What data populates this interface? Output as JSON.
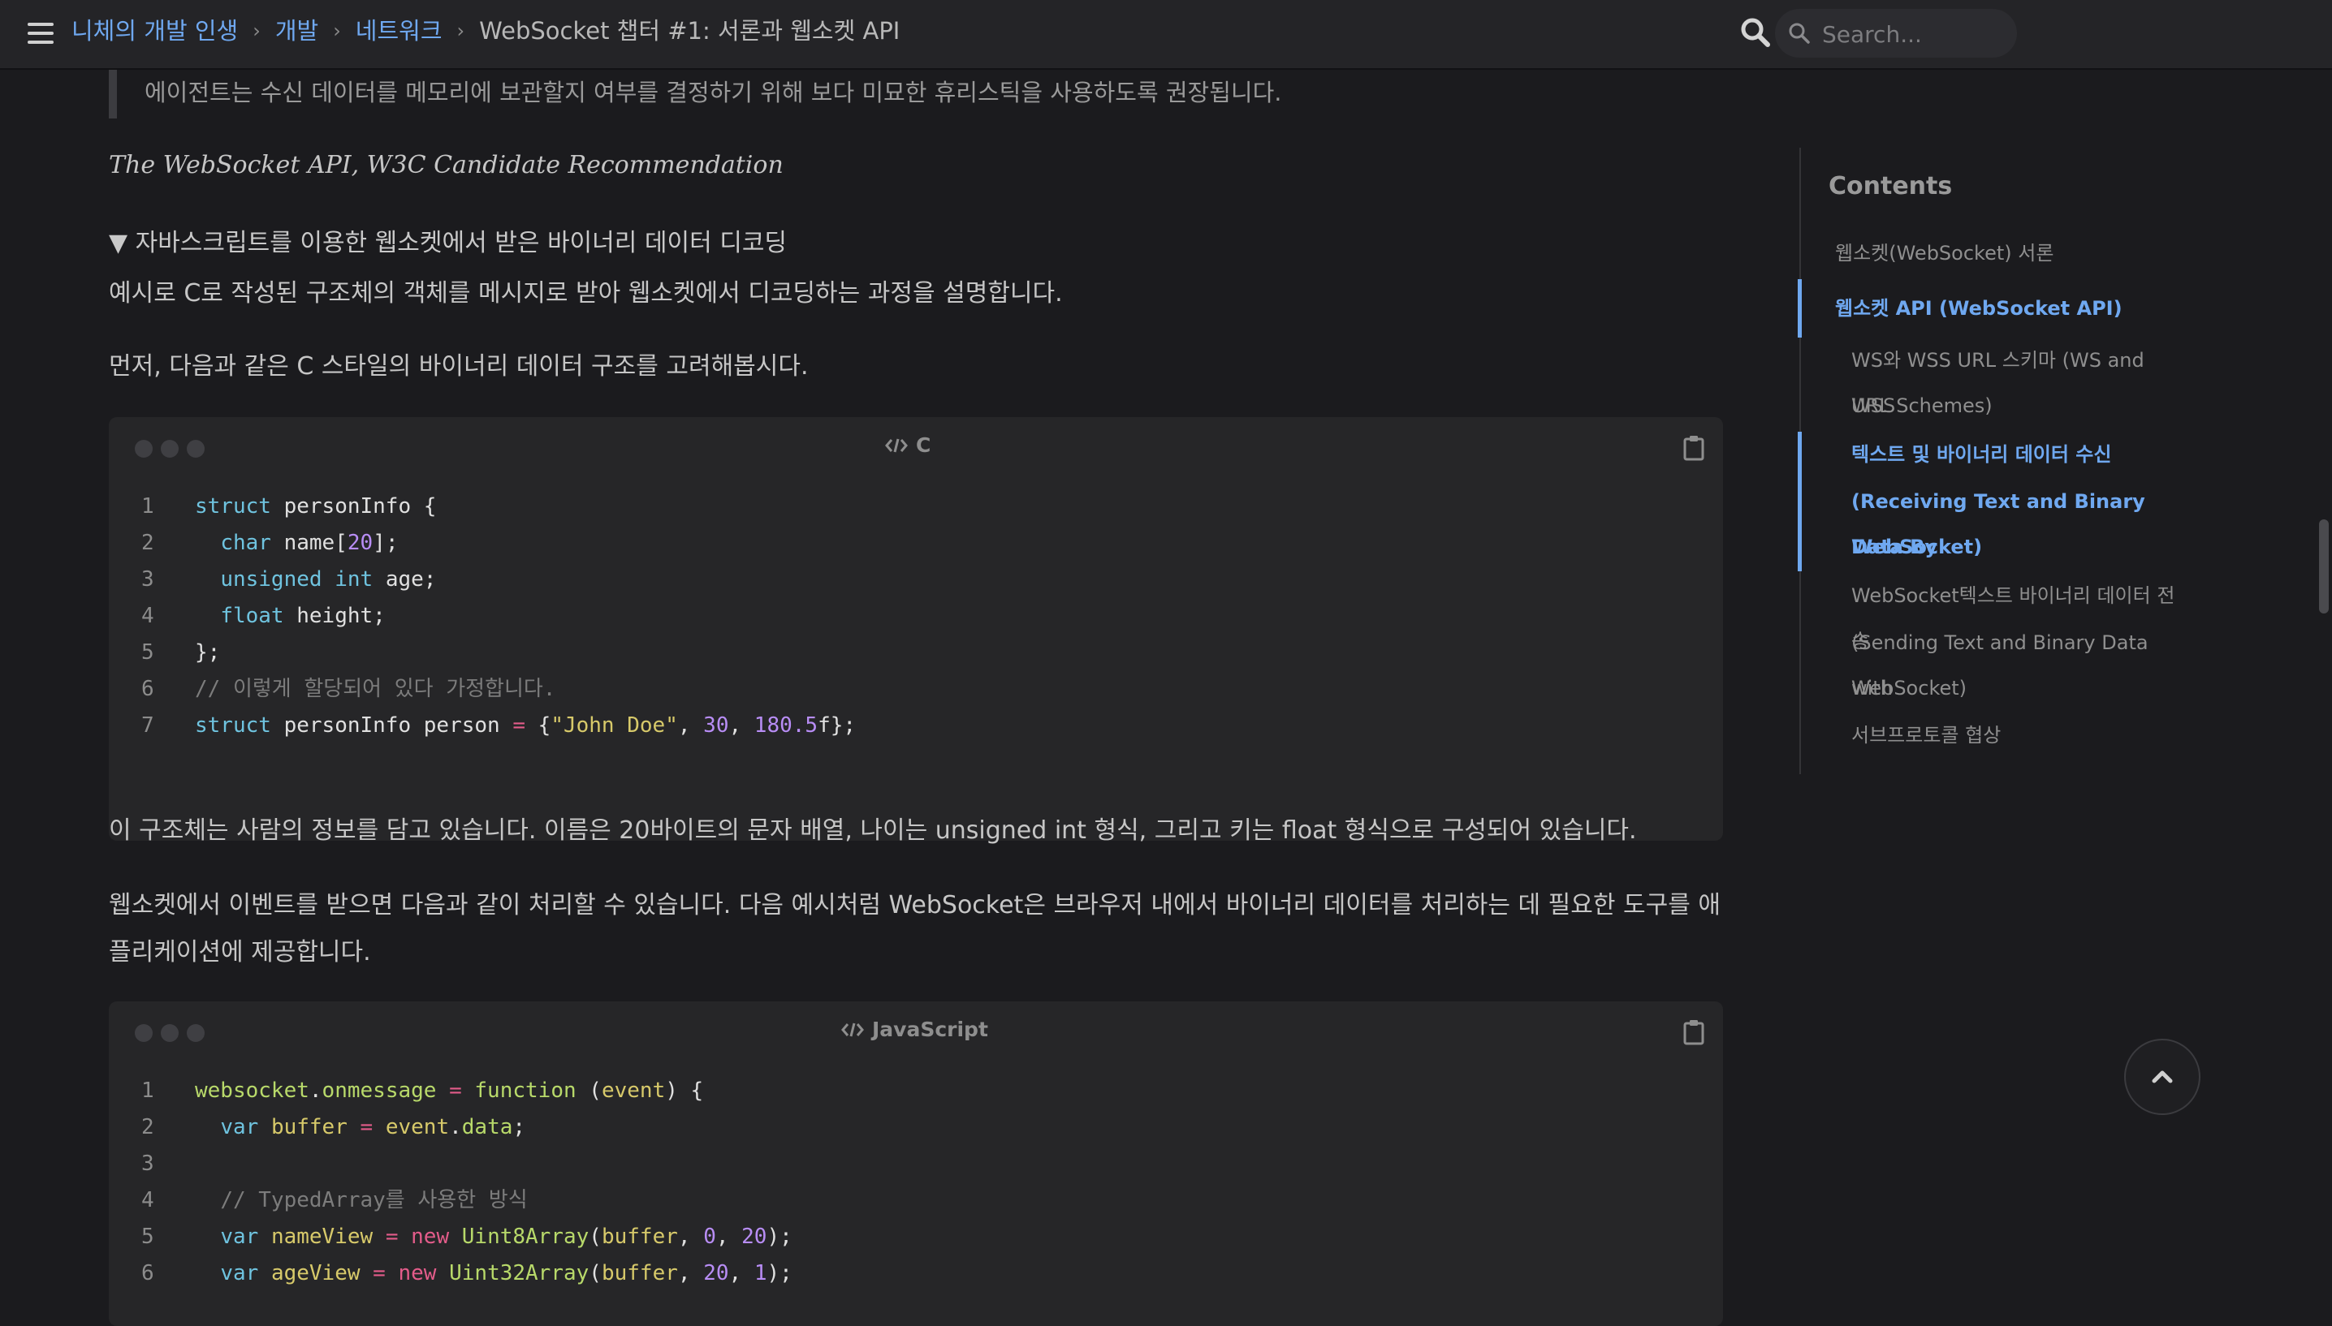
{
  "header": {
    "breadcrumb": {
      "blog": "니체의 개발 인생",
      "category": "개발",
      "subcategory": "네트워크",
      "current": "WebSocket 챕터 #1: 서론과 웹소켓 API"
    },
    "search_placeholder": "Search..."
  },
  "article": {
    "quote": "에이전트는 수신 데이터를 메모리에 보관할지 여부를 결정하기 위해 보다 미묘한 휴리스틱을 사용하도록 권장됩니다.",
    "citation": "The WebSocket API, W3C Candidate Recommendation",
    "details_summary": "▼ 자바스크립트를 이용한 웹소켓에서 받은 바이너리 데이터 디코딩",
    "para1": "예시로 C로 작성된 구조체의 객체를 메시지로 받아 웹소켓에서 디코딩하는 과정을 설명합니다.",
    "para2": "먼저, 다음과 같은 C 스타일의 바이너리 데이터 구조를 고려해봅시다.",
    "para3": "이 구조체는 사람의 정보를 담고 있습니다. 이름은 20바이트의 문자 배열, 나이는 unsigned int 형식, 그리고 키는 float 형식으로 구성되어 있습니다.",
    "para4_line1": "웹소켓에서 이벤트를 받으면 다음과 같이 처리할 수 있습니다. 다음 예시처럼 WebSocket은 브라우저 내에서 바이너리 데이터를 처리하는 데 필요한 도구를 애",
    "para4_line2": "플리케이션에 제공합니다."
  },
  "code_c": {
    "language": "C",
    "line_numbers": [
      "1",
      "2",
      "3",
      "4",
      "5",
      "6",
      "7"
    ],
    "l1": {
      "kw": "struct",
      "rest": " personInfo {"
    },
    "l2": {
      "kw": "char",
      "a": " name[",
      "num": "20",
      "b": "];"
    },
    "l3": {
      "kw1": "unsigned",
      "kw2": "int",
      "rest": " age;"
    },
    "l4": {
      "kw": "float",
      "rest": " height;"
    },
    "l5": "};",
    "l6": "// 이렇게 할당되어 있다 가정합니다.",
    "l7": {
      "kw": "struct",
      "a": " personInfo person ",
      "op": "=",
      "b": " {",
      "str": "\"John Doe\"",
      "c": ", ",
      "n1": "30",
      "d": ", ",
      "n2": "180.5",
      "e": "f};"
    }
  },
  "code_js": {
    "language": "JavaScript",
    "line_numbers": [
      "1",
      "2",
      "3",
      "4",
      "5",
      "6"
    ],
    "l1": {
      "obj": "websocket",
      "dot": ".",
      "prop": "onmessage",
      "op": " = ",
      "kw": "function",
      "rest": " (",
      "param": "event",
      "end": ") {"
    },
    "l2": {
      "kw": "var",
      "a": " ",
      "name": "buffer",
      "op": " = ",
      "obj": "event",
      "b": ".",
      "prop": "data",
      "end": ";"
    },
    "l4": "// TypedArray를 사용한 방식",
    "l5": {
      "kw": "var",
      "a": " ",
      "name": "nameView",
      "op": " = ",
      "new": "new",
      "cls": " Uint8Array",
      "b": "(",
      "arg": "buffer",
      "c": ", ",
      "n1": "0",
      "d": ", ",
      "n2": "20",
      "e": ");"
    },
    "l6": {
      "kw": "var",
      "a": " ",
      "name": "ageView",
      "op": " = ",
      "new": "new",
      "cls": " Uint32Array",
      "b": "(",
      "arg": "buffer",
      "c": ", ",
      "n1": "20",
      "d": ", ",
      "n2": "1",
      "e": ");"
    }
  },
  "toc": {
    "title": "Contents",
    "items": [
      "웹소켓(WebSocket) 서론",
      "웹소켓 API (WebSocket API)",
      "WS와 WSS URL 스키마 (WS and WSS",
      "URL Schemes)",
      "텍스트 및 바이너리 데이터 수신",
      "(Receiving Text and Binary Data By",
      "WebSocket)",
      "WebSocket텍스트 바이너리 데이터 전송",
      "(Sending Text and Binary Data with",
      "WebSocket)",
      "서브프로토콜 협상"
    ]
  },
  "colors": {
    "accent": "#6fa8f0",
    "background": "#1b1b1e",
    "code_background": "#262628"
  }
}
